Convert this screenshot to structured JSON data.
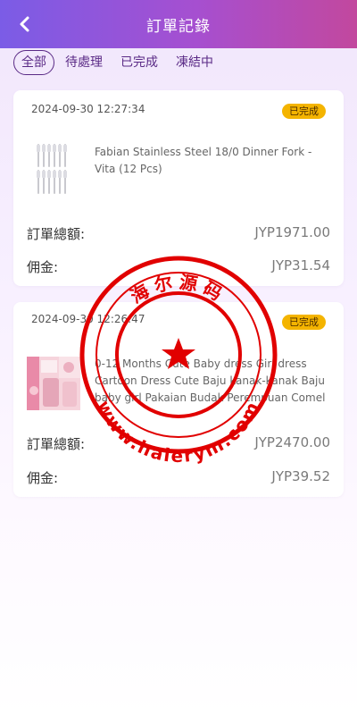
{
  "header": {
    "title": "訂單記錄"
  },
  "tabs": [
    {
      "label": "全部"
    },
    {
      "label": "待處理"
    },
    {
      "label": "已完成"
    },
    {
      "label": "凍結中"
    }
  ],
  "orders": [
    {
      "time": "2024-09-30 12:27:34",
      "status": "已完成",
      "product_name": "Fabian Stainless Steel 18/0 Dinner Fork - Vita (12 Pcs)",
      "total_label": "訂單總額:",
      "total_value": "JYP1971.00",
      "commission_label": "佣金:",
      "commission_value": "JYP31.54"
    },
    {
      "time": "2024-09-30 12:26:47",
      "status": "已完成",
      "product_name": "0-12 Months Cute Baby dress Girl dress Cartoon Dress Cute Baju kanak-kanak Baju baby girl Pakaian Budak Perempuan Comel",
      "total_label": "訂單總額:",
      "total_value": "JYP2470.00",
      "commission_label": "佣金:",
      "commission_value": "JYP39.52"
    }
  ],
  "watermark": {
    "top_text": "海尔源码",
    "bottom_text": "www.haierym.com"
  },
  "colors": {
    "header_start": "#7b5ce6",
    "header_end": "#c2489e",
    "accent": "#5a2a86",
    "badge": "#f4b400",
    "stamp": "#e10000"
  }
}
